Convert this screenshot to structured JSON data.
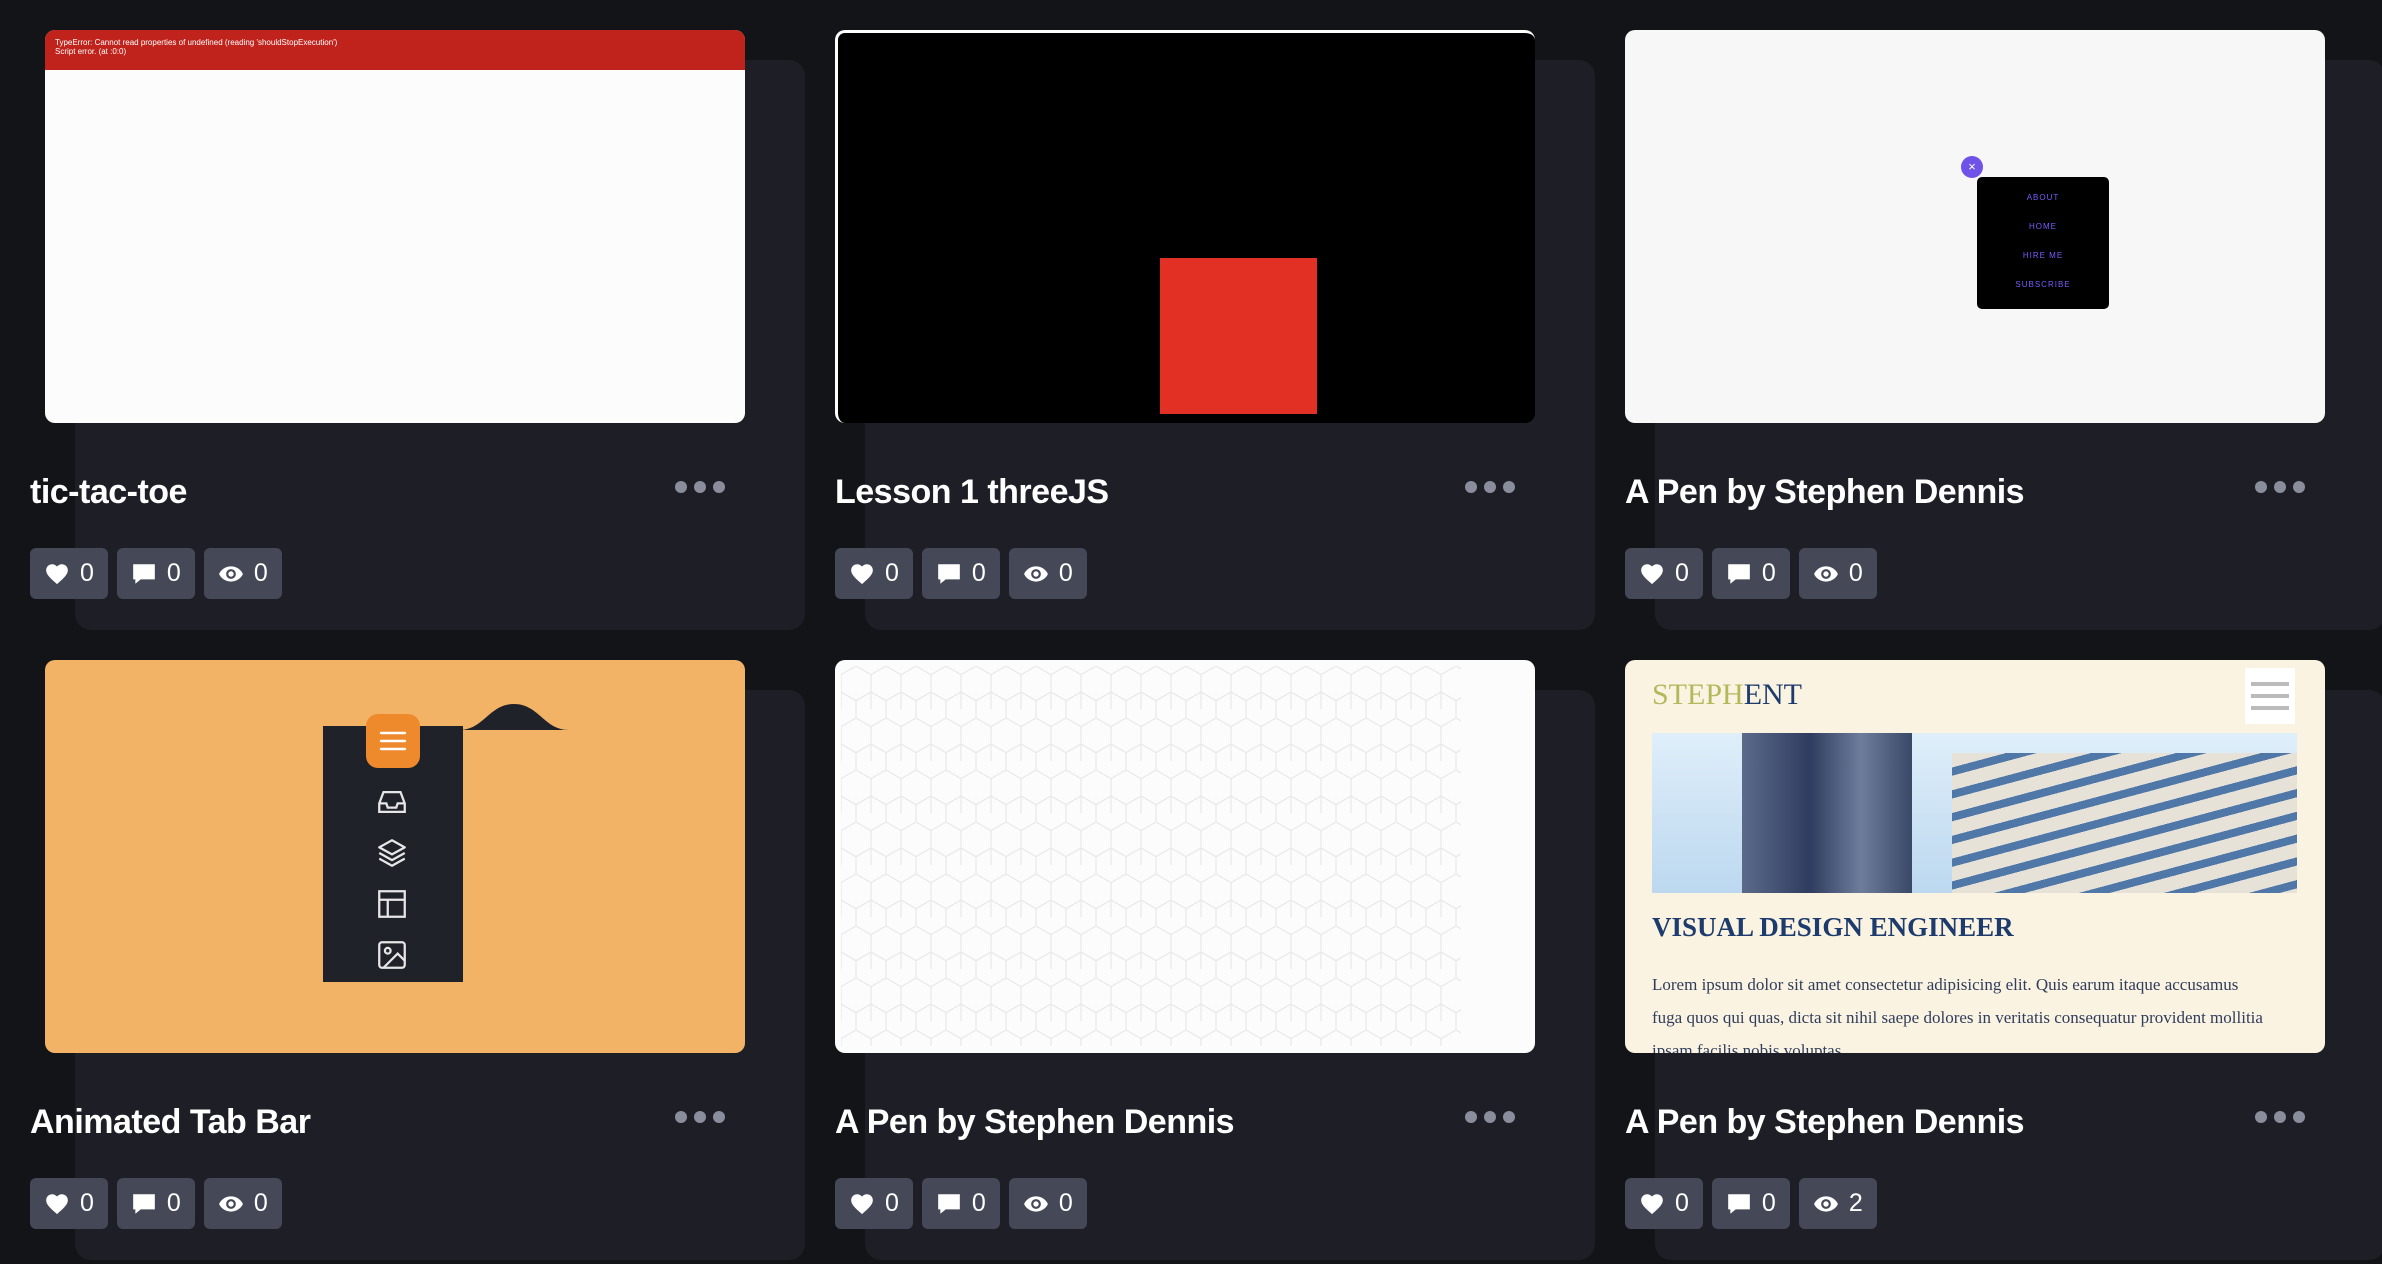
{
  "cards": [
    {
      "title": "tic-tac-toe",
      "preview": {
        "error_line1": "TypeError: Cannot read properties of undefined (reading 'shouldStopExecution')",
        "error_line2": "Script error. (at :0:0)"
      },
      "stats": {
        "likes": "0",
        "comments": "0",
        "views": "0"
      }
    },
    {
      "title": "Lesson 1 threeJS",
      "stats": {
        "likes": "0",
        "comments": "0",
        "views": "0"
      }
    },
    {
      "title": "A Pen by Stephen Dennis",
      "preview": {
        "close": "×",
        "menu_items": [
          "ABOUT",
          "HOME",
          "HIRE ME",
          "SUBSCRIBE"
        ]
      },
      "stats": {
        "likes": "0",
        "comments": "0",
        "views": "0"
      }
    },
    {
      "title": "Animated Tab Bar",
      "stats": {
        "likes": "0",
        "comments": "0",
        "views": "0"
      }
    },
    {
      "title": "A Pen by Stephen Dennis",
      "stats": {
        "likes": "0",
        "comments": "0",
        "views": "0"
      }
    },
    {
      "title": "A Pen by Stephen Dennis",
      "preview": {
        "logo_part1": "STEPH",
        "logo_part2": "ENT",
        "heading": "VISUAL DESIGN ENGINEER",
        "paragraph": "Lorem ipsum dolor sit amet consectetur adipisicing elit. Quis earum itaque accusamus fuga quos qui quas, dicta sit nihil saepe dolores in veritatis consequatur provident mollitia ipsam facilis nobis voluptas."
      },
      "stats": {
        "likes": "0",
        "comments": "0",
        "views": "2"
      }
    }
  ],
  "colors": {
    "page_bg": "#131417",
    "card_bg": "#1e1f26",
    "stat_bg": "#444857",
    "threejs_cube": "#e33024",
    "tabbar_bg": "#f2b367",
    "tabbar_accent": "#ef8a2c",
    "steph_bg": "#fbf3e2",
    "steph_logo_green": "#b3b85b",
    "steph_logo_navy": "#1d3b6c"
  },
  "icons": {
    "like": "heart-icon",
    "comment": "comment-icon",
    "view": "eye-icon",
    "more": "ellipsis-icon"
  }
}
